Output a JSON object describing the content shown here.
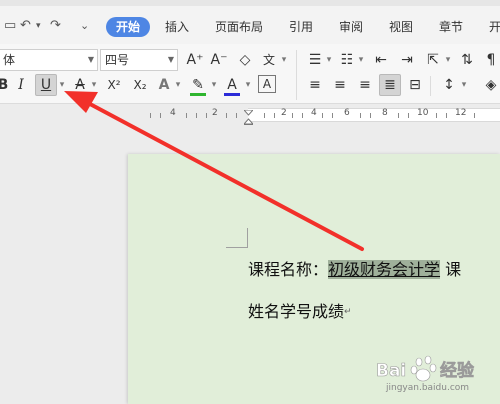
{
  "tabs": {
    "active": "开始",
    "items": [
      "插入",
      "页面布局",
      "引用",
      "审阅",
      "视图",
      "章节",
      "开"
    ]
  },
  "toolbar": {
    "font_name": "体",
    "font_size": "四号",
    "bold": "B",
    "italic": "I",
    "underline": "U",
    "strike": "A",
    "superscript": "X²",
    "subscript": "X₂",
    "font_effect": "A",
    "font_color": "A",
    "char_border": "A",
    "wen": "文",
    "grow": "A⁺",
    "shrink": "A⁻",
    "highlight_color": "#2fb52f",
    "font_color_bar": "#2b2bd8",
    "strike_color": "#e03030"
  },
  "ruler": {
    "labels": [
      "4",
      "2",
      "2",
      "4",
      "6",
      "8",
      "10",
      "12"
    ]
  },
  "document": {
    "label": "课程名称：",
    "highlighted": "初级财务会计学",
    "after": " 课",
    "line2": "姓名学号成绩",
    "para_mark": "↵"
  },
  "watermark": {
    "text": "jingyan.baidu.com",
    "logo": "Baidu"
  }
}
